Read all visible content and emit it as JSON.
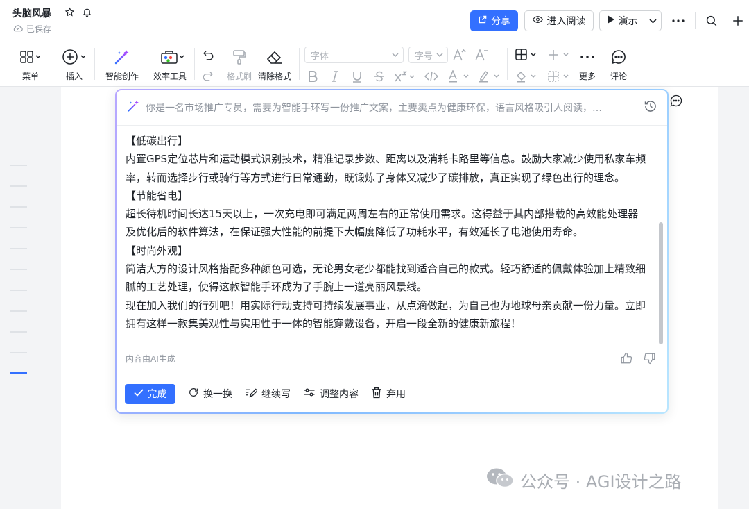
{
  "header": {
    "doc_title": "头脑风暴",
    "saved_status": "已保存",
    "share_label": "分享",
    "reading_mode_label": "进入阅读",
    "present_label": "演示"
  },
  "toolbar": {
    "menu": "菜单",
    "insert": "插入",
    "ai_create": "智能创作",
    "efficiency": "效率工具",
    "format_painter": "格式刷",
    "clear_format": "清除格式",
    "font_placeholder": "字体",
    "size_placeholder": "字号",
    "more": "更多",
    "comment": "评论"
  },
  "ai_panel": {
    "prompt": "你是一名市场推广专员，需要为智能手环写一份推广文案，主要卖点为健康环保，语言风格吸引人阅读，…",
    "paragraphs": [
      "【低碳出行】",
      "内置GPS定位芯片和运动模式识别技术，精准记录步数、距离以及消耗卡路里等信息。鼓励大家减少使用私家车频率，转而选择步行或骑行等方式进行日常通勤，既锻炼了身体又减少了碳排放，真正实现了绿色出行的理念。",
      "【节能省电】",
      "超长待机时间长达15天以上，一次充电即可满足两周左右的正常使用需求。这得益于其内部搭载的高效能处理器及优化后的软件算法，在保证强大性能的前提下大幅度降低了功耗水平，有效延长了电池使用寿命。",
      "【时尚外观】",
      "简洁大方的设计风格搭配多种颜色可选，无论男女老少都能找到适合自己的款式。轻巧舒适的佩戴体验加上精致细腻的工艺处理，使得这款智能手环成为了手腕上一道亮丽风景线。",
      "现在加入我们的行列吧！用实际行动支持可持续发展事业，从点滴做起，为自己也为地球母亲贡献一份力量。立即拥有这样一款集美观性与实用性于一体的智能穿戴设备，开启一段全新的健康新旅程！"
    ],
    "ai_note": "内容由AI生成",
    "actions": {
      "done": "完成",
      "regenerate": "换一换",
      "continue": "继续写",
      "adjust": "调整内容",
      "discard": "弃用"
    }
  },
  "watermark": "公众号 · AGI设计之路",
  "colors": {
    "accent": "#3370ff",
    "text": "#1f2329",
    "muted": "#8f959e"
  }
}
